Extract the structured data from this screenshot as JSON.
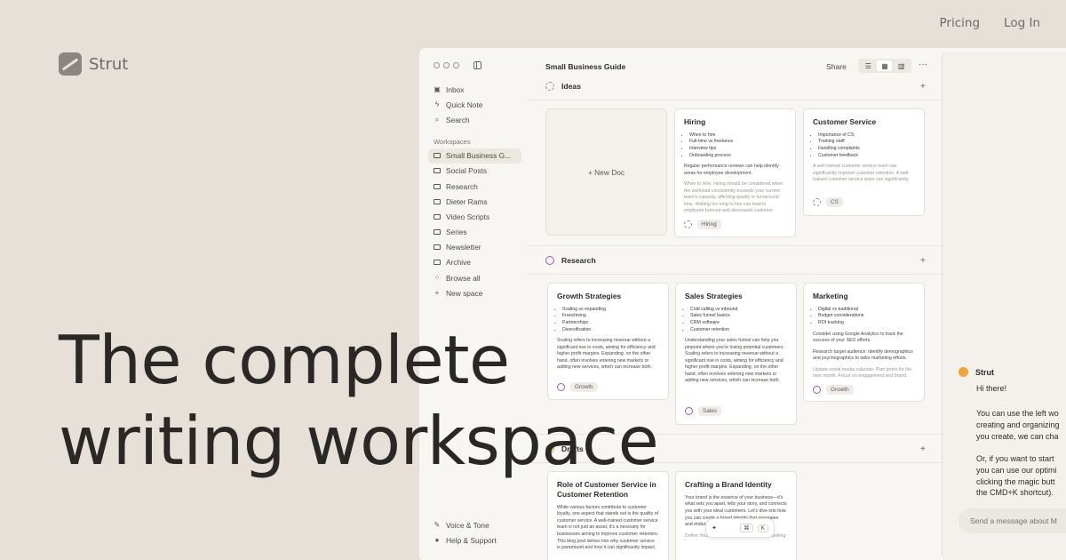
{
  "brand": {
    "name": "Strut"
  },
  "topnav": {
    "pricing": "Pricing",
    "login": "Log In"
  },
  "hero": {
    "line1": "The complete",
    "line2": "writing workspace"
  },
  "sidebar": {
    "top_items": [
      {
        "label": "Inbox",
        "icon": "inbox-icon"
      },
      {
        "label": "Quick Note",
        "icon": "bolt-icon"
      },
      {
        "label": "Search",
        "icon": "search-icon"
      }
    ],
    "section_label": "Workspaces",
    "workspaces": [
      "Small Business G...",
      "Social Posts",
      "Research",
      "Dieter Rams",
      "Video Scripts",
      "Series",
      "Newsletter",
      "Archive"
    ],
    "browse_all": "Browse all",
    "new_space": "New space",
    "bottom_items": [
      {
        "label": "Voice & Tone",
        "icon": "pen-icon"
      },
      {
        "label": "Help & Support",
        "icon": "help-icon"
      }
    ]
  },
  "main": {
    "title": "Small Business Guide",
    "share": "Share",
    "groups": {
      "ideas": "Ideas",
      "research": "Research",
      "drafts": "Drafts"
    },
    "new_doc": "+ New Doc",
    "cards": {
      "hiring": {
        "title": "Hiring",
        "bullets": [
          "When to hire",
          "Full-time vs freelance",
          "Interview tips",
          "Onboarding process"
        ],
        "p1": "Regular performance reviews can help identify areas for employee development.",
        "p2": "When to Hire: Hiring should be considered when the workload consistently exceeds your current team's capacity, affecting quality or turnaround time. Waiting too long to hire can lead to employee burnout and decreased customer satisfaction.",
        "tag": "Hiring"
      },
      "customer_service": {
        "title": "Customer Service",
        "bullets": [
          "Importance of CS",
          "Training staff",
          "Handling complaints",
          "Customer feedback"
        ],
        "p1": "A well-trained customer service team can significantly improve customer retention. A well-trained customer service team can significantly.",
        "tag": "CS"
      },
      "growth": {
        "title": "Growth Strategies",
        "bullets": [
          "Scaling vs expanding",
          "Franchising",
          "Partnerships",
          "Diversification"
        ],
        "p1": "Scaling refers to increasing revenue without a significant rise in costs, aiming for efficiency and higher profit margins. Expanding, on the other hand, often involves entering new markets or adding new services, which can increase both.",
        "tag": "Growth"
      },
      "sales": {
        "title": "Sales Strategies",
        "bullets": [
          "Cold calling vs inbound",
          "Sales funnel basics",
          "CRM software",
          "Customer retention"
        ],
        "p1": "Understanding your sales funnel can help you pinpoint where you're losing potential customers. Scaling refers to increasing revenue without a significant rise in costs, aiming for efficiency and higher profit margins. Expanding, on the other hand, often involves entering new markets or adding new services, which can increase both.",
        "tag": "Sales"
      },
      "marketing": {
        "title": "Marketing",
        "bullets": [
          "Digital vs traditional",
          "Budget considerations",
          "ROI tracking"
        ],
        "p1": "Consider using Google Analytics to track the success of your SEO efforts.",
        "p2": "Research target audience; identify demographics and psychographics to tailor marketing efforts.",
        "p3": "Update social media calendar. Plan posts for the next month. Focus on engagement and brand.",
        "tag": "Growth"
      },
      "retention": {
        "title": "Role of Customer Service in Customer Retention",
        "p1": "While various factors contribute to customer loyalty, one aspect that stands out is the quality of customer service. A well-trained customer service team is not just an asset; it's a necessity for businesses aiming to improve customer retention. This blog post delves into why customer service is paramount and how it can significantly impact."
      },
      "brand": {
        "title": "Crafting a Brand Identity",
        "p1": "Your brand is the essence of your business—it's what sets you apart, tells your story, and connects you with your ideal customers. Let's dive into how you can create a brand identity that resonates and endures.",
        "p2": "Define Your Brand Identity: Creating a compelling brand"
      }
    },
    "floatbar": {
      "kbd1": "⌘",
      "kbd2": "K"
    }
  },
  "chat": {
    "name": "Strut",
    "greeting": "Hi there!",
    "msg1_lines": [
      "You can use the left wo",
      "creating and organizing",
      "you create, we can cha"
    ],
    "msg2_lines": [
      "Or, if you want to start",
      "you can use our optimi",
      "clicking the magic butt",
      "the CMD+K shortcut)."
    ],
    "input_placeholder": "Send a message about M"
  },
  "colors": {
    "background": "#e6e0d8",
    "accent_orange": "#f2a33a",
    "research_purple": "#9b59b6"
  }
}
